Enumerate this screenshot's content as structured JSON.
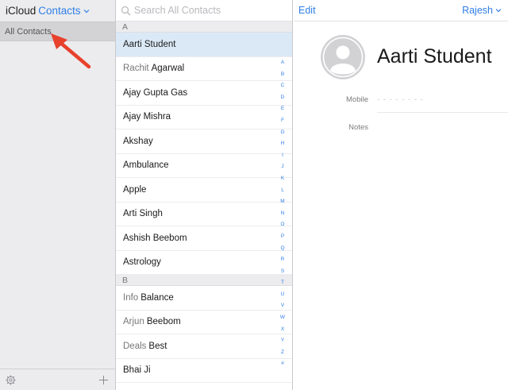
{
  "sidebar": {
    "brand": "iCloud",
    "app_name": "Contacts",
    "group": "All Contacts"
  },
  "search": {
    "placeholder": "Search All Contacts"
  },
  "sections": [
    {
      "letter": "A",
      "contacts": [
        {
          "first": "",
          "last": "Aarti Student",
          "selected": true
        },
        {
          "first": "Rachit",
          "last": "Agarwal"
        },
        {
          "first": "",
          "last": "Ajay Gupta Gas"
        },
        {
          "first": "",
          "last": "Ajay Mishra"
        },
        {
          "first": "",
          "last": "Akshay"
        },
        {
          "first": "",
          "last": "Ambulance"
        },
        {
          "first": "",
          "last": "Apple"
        },
        {
          "first": "",
          "last": "Arti Singh"
        },
        {
          "first": "",
          "last": "Ashish Beebom"
        },
        {
          "first": "",
          "last": "Astrology"
        }
      ]
    },
    {
      "letter": "B",
      "contacts": [
        {
          "first": "Info",
          "last": "Balance"
        },
        {
          "first": "Arjun",
          "last": "Beebom"
        },
        {
          "first": "Deals",
          "last": "Best"
        },
        {
          "first": "",
          "last": "Bhai Ji"
        }
      ]
    }
  ],
  "index_letters": [
    "A",
    "B",
    "C",
    "D",
    "E",
    "F",
    "G",
    "H",
    "I",
    "J",
    "K",
    "L",
    "M",
    "N",
    "O",
    "P",
    "Q",
    "R",
    "S",
    "T",
    "U",
    "V",
    "W",
    "X",
    "Y",
    "Z",
    "#"
  ],
  "detail": {
    "edit_label": "Edit",
    "user_label": "Rajesh",
    "contact_name": "Aarti Student",
    "mobile_label": "Mobile",
    "mobile_value": "- - - - - - - -",
    "notes_label": "Notes"
  },
  "colors": {
    "accent": "#2f7ee6",
    "arrow": "#e8412c",
    "selected_row": "#dbe9f7"
  },
  "icons": [
    "chevron-down-icon",
    "search-icon",
    "arrow-annotation",
    "gear-icon",
    "plus-icon",
    "avatar-placeholder-icon"
  ]
}
